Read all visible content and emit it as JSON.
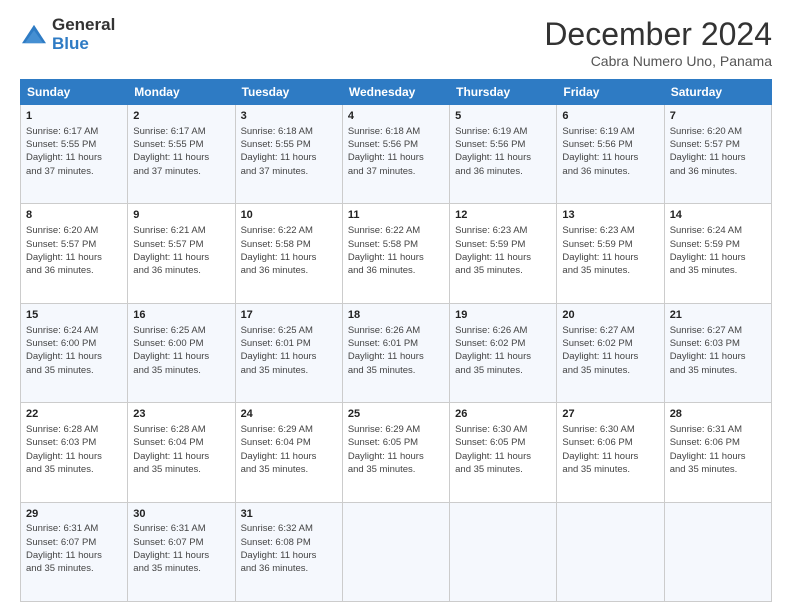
{
  "logo": {
    "line1": "General",
    "line2": "Blue"
  },
  "title": "December 2024",
  "subtitle": "Cabra Numero Uno, Panama",
  "weekdays": [
    "Sunday",
    "Monday",
    "Tuesday",
    "Wednesday",
    "Thursday",
    "Friday",
    "Saturday"
  ],
  "weeks": [
    [
      {
        "day": "1",
        "lines": [
          "Sunrise: 6:17 AM",
          "Sunset: 5:55 PM",
          "Daylight: 11 hours",
          "and 37 minutes."
        ]
      },
      {
        "day": "2",
        "lines": [
          "Sunrise: 6:17 AM",
          "Sunset: 5:55 PM",
          "Daylight: 11 hours",
          "and 37 minutes."
        ]
      },
      {
        "day": "3",
        "lines": [
          "Sunrise: 6:18 AM",
          "Sunset: 5:55 PM",
          "Daylight: 11 hours",
          "and 37 minutes."
        ]
      },
      {
        "day": "4",
        "lines": [
          "Sunrise: 6:18 AM",
          "Sunset: 5:56 PM",
          "Daylight: 11 hours",
          "and 37 minutes."
        ]
      },
      {
        "day": "5",
        "lines": [
          "Sunrise: 6:19 AM",
          "Sunset: 5:56 PM",
          "Daylight: 11 hours",
          "and 36 minutes."
        ]
      },
      {
        "day": "6",
        "lines": [
          "Sunrise: 6:19 AM",
          "Sunset: 5:56 PM",
          "Daylight: 11 hours",
          "and 36 minutes."
        ]
      },
      {
        "day": "7",
        "lines": [
          "Sunrise: 6:20 AM",
          "Sunset: 5:57 PM",
          "Daylight: 11 hours",
          "and 36 minutes."
        ]
      }
    ],
    [
      {
        "day": "8",
        "lines": [
          "Sunrise: 6:20 AM",
          "Sunset: 5:57 PM",
          "Daylight: 11 hours",
          "and 36 minutes."
        ]
      },
      {
        "day": "9",
        "lines": [
          "Sunrise: 6:21 AM",
          "Sunset: 5:57 PM",
          "Daylight: 11 hours",
          "and 36 minutes."
        ]
      },
      {
        "day": "10",
        "lines": [
          "Sunrise: 6:22 AM",
          "Sunset: 5:58 PM",
          "Daylight: 11 hours",
          "and 36 minutes."
        ]
      },
      {
        "day": "11",
        "lines": [
          "Sunrise: 6:22 AM",
          "Sunset: 5:58 PM",
          "Daylight: 11 hours",
          "and 36 minutes."
        ]
      },
      {
        "day": "12",
        "lines": [
          "Sunrise: 6:23 AM",
          "Sunset: 5:59 PM",
          "Daylight: 11 hours",
          "and 35 minutes."
        ]
      },
      {
        "day": "13",
        "lines": [
          "Sunrise: 6:23 AM",
          "Sunset: 5:59 PM",
          "Daylight: 11 hours",
          "and 35 minutes."
        ]
      },
      {
        "day": "14",
        "lines": [
          "Sunrise: 6:24 AM",
          "Sunset: 5:59 PM",
          "Daylight: 11 hours",
          "and 35 minutes."
        ]
      }
    ],
    [
      {
        "day": "15",
        "lines": [
          "Sunrise: 6:24 AM",
          "Sunset: 6:00 PM",
          "Daylight: 11 hours",
          "and 35 minutes."
        ]
      },
      {
        "day": "16",
        "lines": [
          "Sunrise: 6:25 AM",
          "Sunset: 6:00 PM",
          "Daylight: 11 hours",
          "and 35 minutes."
        ]
      },
      {
        "day": "17",
        "lines": [
          "Sunrise: 6:25 AM",
          "Sunset: 6:01 PM",
          "Daylight: 11 hours",
          "and 35 minutes."
        ]
      },
      {
        "day": "18",
        "lines": [
          "Sunrise: 6:26 AM",
          "Sunset: 6:01 PM",
          "Daylight: 11 hours",
          "and 35 minutes."
        ]
      },
      {
        "day": "19",
        "lines": [
          "Sunrise: 6:26 AM",
          "Sunset: 6:02 PM",
          "Daylight: 11 hours",
          "and 35 minutes."
        ]
      },
      {
        "day": "20",
        "lines": [
          "Sunrise: 6:27 AM",
          "Sunset: 6:02 PM",
          "Daylight: 11 hours",
          "and 35 minutes."
        ]
      },
      {
        "day": "21",
        "lines": [
          "Sunrise: 6:27 AM",
          "Sunset: 6:03 PM",
          "Daylight: 11 hours",
          "and 35 minutes."
        ]
      }
    ],
    [
      {
        "day": "22",
        "lines": [
          "Sunrise: 6:28 AM",
          "Sunset: 6:03 PM",
          "Daylight: 11 hours",
          "and 35 minutes."
        ]
      },
      {
        "day": "23",
        "lines": [
          "Sunrise: 6:28 AM",
          "Sunset: 6:04 PM",
          "Daylight: 11 hours",
          "and 35 minutes."
        ]
      },
      {
        "day": "24",
        "lines": [
          "Sunrise: 6:29 AM",
          "Sunset: 6:04 PM",
          "Daylight: 11 hours",
          "and 35 minutes."
        ]
      },
      {
        "day": "25",
        "lines": [
          "Sunrise: 6:29 AM",
          "Sunset: 6:05 PM",
          "Daylight: 11 hours",
          "and 35 minutes."
        ]
      },
      {
        "day": "26",
        "lines": [
          "Sunrise: 6:30 AM",
          "Sunset: 6:05 PM",
          "Daylight: 11 hours",
          "and 35 minutes."
        ]
      },
      {
        "day": "27",
        "lines": [
          "Sunrise: 6:30 AM",
          "Sunset: 6:06 PM",
          "Daylight: 11 hours",
          "and 35 minutes."
        ]
      },
      {
        "day": "28",
        "lines": [
          "Sunrise: 6:31 AM",
          "Sunset: 6:06 PM",
          "Daylight: 11 hours",
          "and 35 minutes."
        ]
      }
    ],
    [
      {
        "day": "29",
        "lines": [
          "Sunrise: 6:31 AM",
          "Sunset: 6:07 PM",
          "Daylight: 11 hours",
          "and 35 minutes."
        ]
      },
      {
        "day": "30",
        "lines": [
          "Sunrise: 6:31 AM",
          "Sunset: 6:07 PM",
          "Daylight: 11 hours",
          "and 35 minutes."
        ]
      },
      {
        "day": "31",
        "lines": [
          "Sunrise: 6:32 AM",
          "Sunset: 6:08 PM",
          "Daylight: 11 hours",
          "and 36 minutes."
        ]
      },
      null,
      null,
      null,
      null
    ]
  ]
}
